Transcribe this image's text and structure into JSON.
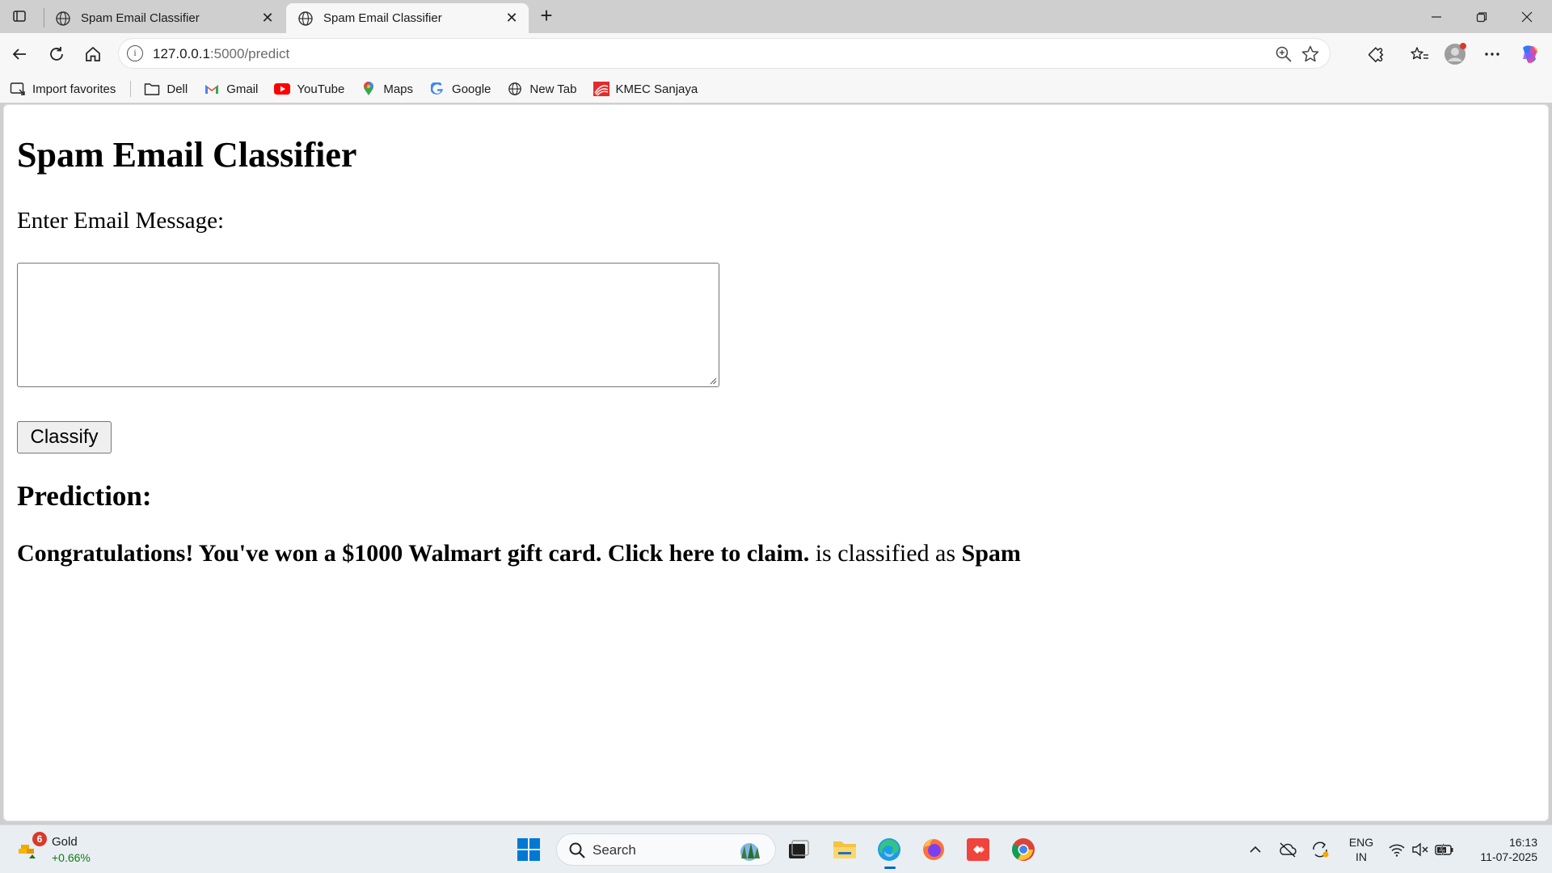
{
  "browser": {
    "tabs": [
      {
        "title": "Spam Email Classifier"
      },
      {
        "title": "Spam Email Classifier"
      }
    ],
    "address": {
      "host": "127.0.0.1",
      "path": ":5000/predict"
    },
    "bookmarks": [
      {
        "label": "Import favorites",
        "icon": "import-icon"
      },
      {
        "label": "Dell",
        "icon": "folder-icon"
      },
      {
        "label": "Gmail",
        "icon": "gmail-icon"
      },
      {
        "label": "YouTube",
        "icon": "youtube-icon"
      },
      {
        "label": "Maps",
        "icon": "maps-pin-icon"
      },
      {
        "label": "Google",
        "icon": "google-icon"
      },
      {
        "label": "New Tab",
        "icon": "globe-icon"
      },
      {
        "label": "KMEC Sanjaya",
        "icon": "kmec-logo-icon"
      }
    ]
  },
  "page": {
    "heading": "Spam Email Classifier",
    "input_label": "Enter Email Message:",
    "textarea_value": "",
    "classify_button": "Classify",
    "prediction_heading": "Prediction:",
    "result": {
      "message": "Congratulations! You've won a $1000 Walmart gift card. Click here to claim.",
      "connector": " is classified as ",
      "label": "Spam"
    }
  },
  "taskbar": {
    "widget": {
      "badge": "6",
      "title": "Gold",
      "change": "+0.66%"
    },
    "search_placeholder": "Search",
    "language": {
      "line1": "ENG",
      "line2": "IN"
    },
    "clock": {
      "time": "16:13",
      "date": "11-07-2025"
    }
  },
  "colors": {
    "edge_blue": "#0067c0",
    "gain_green": "#107c10",
    "badge_red": "#d83b2b"
  }
}
